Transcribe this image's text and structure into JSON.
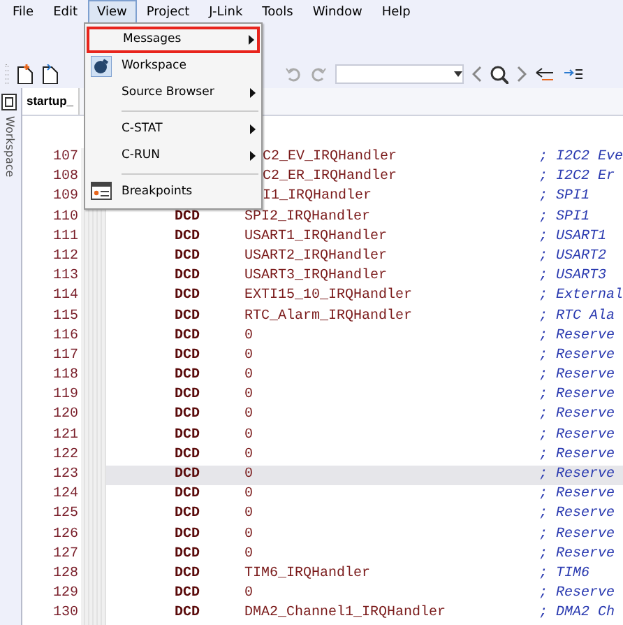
{
  "menu_bar": [
    {
      "label": "File",
      "selected": false
    },
    {
      "label": "Edit",
      "selected": false
    },
    {
      "label": "View",
      "selected": true
    },
    {
      "label": "Project",
      "selected": false
    },
    {
      "label": "J-Link",
      "selected": false
    },
    {
      "label": "Tools",
      "selected": false
    },
    {
      "label": "Window",
      "selected": false
    },
    {
      "label": "Help",
      "selected": false
    }
  ],
  "view_menu": [
    {
      "kind": "item",
      "label": "Messages",
      "submenu": true,
      "highlighted": true,
      "icon": false
    },
    {
      "kind": "item",
      "label": "Workspace",
      "submenu": false,
      "highlighted": false,
      "icon": true
    },
    {
      "kind": "item",
      "label": "Source Browser",
      "submenu": true,
      "highlighted": false,
      "icon": false
    },
    {
      "kind": "separator"
    },
    {
      "kind": "item",
      "label": "C-STAT",
      "submenu": true,
      "highlighted": false,
      "icon": false
    },
    {
      "kind": "item",
      "label": "C-RUN",
      "submenu": true,
      "highlighted": false,
      "icon": false
    },
    {
      "kind": "separator"
    },
    {
      "kind": "item",
      "label": "Breakpoints",
      "submenu": false,
      "highlighted": false,
      "icon": true
    }
  ],
  "side_panel": {
    "label": "Workspace"
  },
  "editor_tab": {
    "label": "startup_"
  },
  "code": [
    {
      "line": "107",
      "symbol": "C2_EV_IRQHandler",
      "comment": "; I2C2 Eve",
      "under_menu": true,
      "current": false
    },
    {
      "line": "108",
      "symbol": "C2_ER_IRQHandler",
      "comment": "; I2C2 Er",
      "under_menu": true,
      "current": false
    },
    {
      "line": "109",
      "symbol": "I1_IRQHandler",
      "comment": "; SPI1",
      "under_menu": true,
      "current": false
    },
    {
      "line": "110",
      "directive": "DCD",
      "symbol": "SPI2_IRQHandler",
      "comment": "; SPI1",
      "under_menu": false,
      "current": false
    },
    {
      "line": "111",
      "directive": "DCD",
      "symbol": "USART1_IRQHandler",
      "comment": "; USART1",
      "under_menu": false,
      "current": false
    },
    {
      "line": "112",
      "directive": "DCD",
      "symbol": "USART2_IRQHandler",
      "comment": "; USART2",
      "under_menu": false,
      "current": false
    },
    {
      "line": "113",
      "directive": "DCD",
      "symbol": "USART3_IRQHandler",
      "comment": "; USART3",
      "under_menu": false,
      "current": false
    },
    {
      "line": "114",
      "directive": "DCD",
      "symbol": "EXTI15_10_IRQHandler",
      "comment": "; External",
      "under_menu": false,
      "current": false
    },
    {
      "line": "115",
      "directive": "DCD",
      "symbol": "RTC_Alarm_IRQHandler",
      "comment": "; RTC Ala",
      "under_menu": false,
      "current": false
    },
    {
      "line": "116",
      "directive": "DCD",
      "symbol": "0",
      "comment": "; Reserve",
      "under_menu": false,
      "current": false
    },
    {
      "line": "117",
      "directive": "DCD",
      "symbol": "0",
      "comment": "; Reserve",
      "under_menu": false,
      "current": false
    },
    {
      "line": "118",
      "directive": "DCD",
      "symbol": "0",
      "comment": "; Reserve",
      "under_menu": false,
      "current": false
    },
    {
      "line": "119",
      "directive": "DCD",
      "symbol": "0",
      "comment": "; Reserve",
      "under_menu": false,
      "current": false
    },
    {
      "line": "120",
      "directive": "DCD",
      "symbol": "0",
      "comment": "; Reserve",
      "under_menu": false,
      "current": false
    },
    {
      "line": "121",
      "directive": "DCD",
      "symbol": "0",
      "comment": "; Reserve",
      "under_menu": false,
      "current": false
    },
    {
      "line": "122",
      "directive": "DCD",
      "symbol": "0",
      "comment": "; Reserve",
      "under_menu": false,
      "current": false
    },
    {
      "line": "123",
      "directive": "DCD",
      "symbol": "0",
      "comment": "; Reserve",
      "under_menu": false,
      "current": true
    },
    {
      "line": "124",
      "directive": "DCD",
      "symbol": "0",
      "comment": "; Reserve",
      "under_menu": false,
      "current": false
    },
    {
      "line": "125",
      "directive": "DCD",
      "symbol": "0",
      "comment": "; Reserve",
      "under_menu": false,
      "current": false
    },
    {
      "line": "126",
      "directive": "DCD",
      "symbol": "0",
      "comment": "; Reserve",
      "under_menu": false,
      "current": false
    },
    {
      "line": "127",
      "directive": "DCD",
      "symbol": "0",
      "comment": "; Reserve",
      "under_menu": false,
      "current": false
    },
    {
      "line": "128",
      "directive": "DCD",
      "symbol": "TIM6_IRQHandler",
      "comment": "; TIM6",
      "under_menu": false,
      "current": false
    },
    {
      "line": "129",
      "directive": "DCD",
      "symbol": "0",
      "comment": "; Reserve",
      "under_menu": false,
      "current": false
    },
    {
      "line": "130",
      "directive": "DCD",
      "symbol": "DMA2_Channel1_IRQHandler",
      "comment": "; DMA2 Ch",
      "under_menu": false,
      "current": false
    }
  ]
}
